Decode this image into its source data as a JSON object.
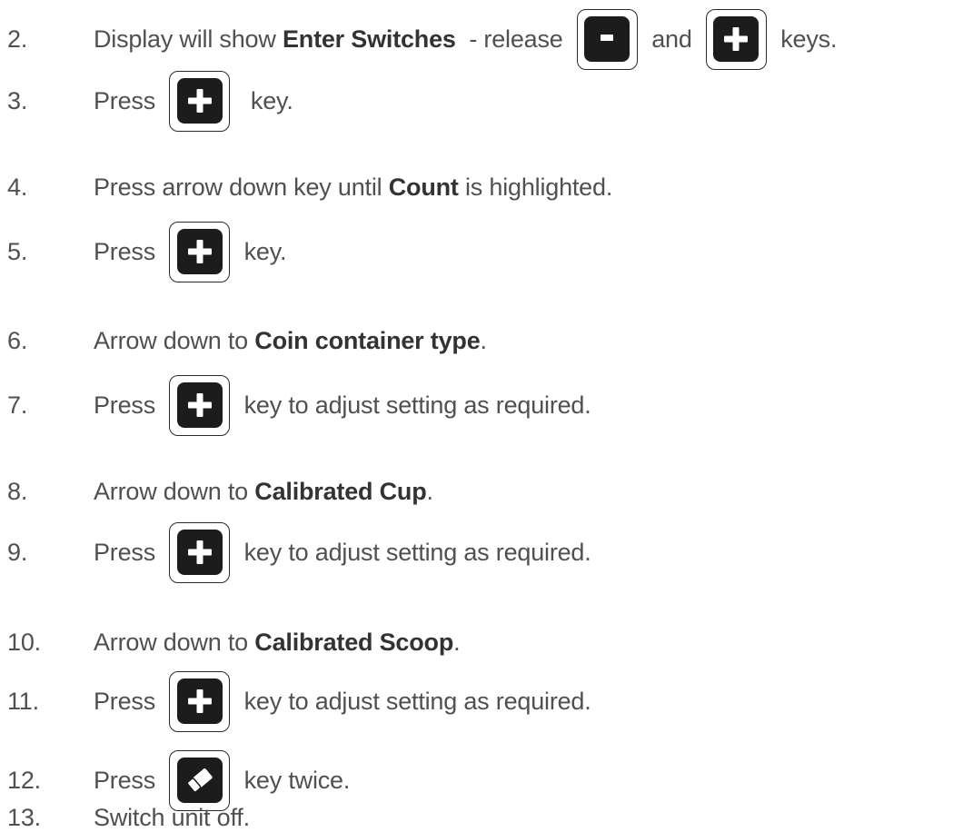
{
  "steps": [
    {
      "num": "2.",
      "parts": [
        {
          "t": "text",
          "v": "Display will show "
        },
        {
          "t": "bold",
          "v": "Enter Switches"
        },
        {
          "t": "text",
          "v": "  - release "
        },
        {
          "t": "icon",
          "icon": "minus-key-icon"
        },
        {
          "t": "text",
          "v": " and "
        },
        {
          "t": "icon",
          "icon": "plus-key-icon"
        },
        {
          "t": "text",
          "v": " keys."
        }
      ]
    },
    {
      "num": "3.",
      "parts": [
        {
          "t": "text",
          "v": "Press "
        },
        {
          "t": "icon",
          "icon": "plus-key-icon"
        },
        {
          "t": "text",
          "v": "  key."
        }
      ]
    },
    {
      "num": "4.",
      "parts": [
        {
          "t": "text",
          "v": "Press arrow down key until "
        },
        {
          "t": "bold",
          "v": "Count"
        },
        {
          "t": "text",
          "v": " is highlighted."
        }
      ]
    },
    {
      "num": "5.",
      "parts": [
        {
          "t": "text",
          "v": "Press "
        },
        {
          "t": "icon",
          "icon": "plus-key-icon"
        },
        {
          "t": "text",
          "v": " key."
        }
      ]
    },
    {
      "num": "6.",
      "parts": [
        {
          "t": "text",
          "v": "Arrow down to "
        },
        {
          "t": "bold",
          "v": "Coin container type"
        },
        {
          "t": "text",
          "v": "."
        }
      ]
    },
    {
      "num": "7.",
      "parts": [
        {
          "t": "text",
          "v": "Press "
        },
        {
          "t": "icon",
          "icon": "plus-key-icon"
        },
        {
          "t": "text",
          "v": " key to adjust setting as required."
        }
      ]
    },
    {
      "num": "8.",
      "parts": [
        {
          "t": "text",
          "v": "Arrow down to "
        },
        {
          "t": "bold",
          "v": "Calibrated Cup"
        },
        {
          "t": "text",
          "v": "."
        }
      ]
    },
    {
      "num": "9.",
      "parts": [
        {
          "t": "text",
          "v": "Press "
        },
        {
          "t": "icon",
          "icon": "plus-key-icon"
        },
        {
          "t": "text",
          "v": " key to adjust setting as required."
        }
      ]
    },
    {
      "num": "10.",
      "parts": [
        {
          "t": "text",
          "v": "Arrow down to "
        },
        {
          "t": "bold",
          "v": "Calibrated Scoop"
        },
        {
          "t": "text",
          "v": "."
        }
      ]
    },
    {
      "num": "11.",
      "parts": [
        {
          "t": "text",
          "v": "Press "
        },
        {
          "t": "icon",
          "icon": "plus-key-icon"
        },
        {
          "t": "text",
          "v": " key to adjust setting as required."
        }
      ]
    },
    {
      "num": "12.",
      "parts": [
        {
          "t": "text",
          "v": "Press "
        },
        {
          "t": "icon",
          "icon": "eraser-key-icon"
        },
        {
          "t": "text",
          "v": " key twice."
        }
      ]
    },
    {
      "num": "13.",
      "parts": [
        {
          "t": "text",
          "v": "Switch unit off."
        }
      ]
    }
  ],
  "colors": {
    "text": "#505050",
    "bold": "#333333",
    "key_fill": "#1c1c1c",
    "key_border": "#2a2a2a"
  }
}
